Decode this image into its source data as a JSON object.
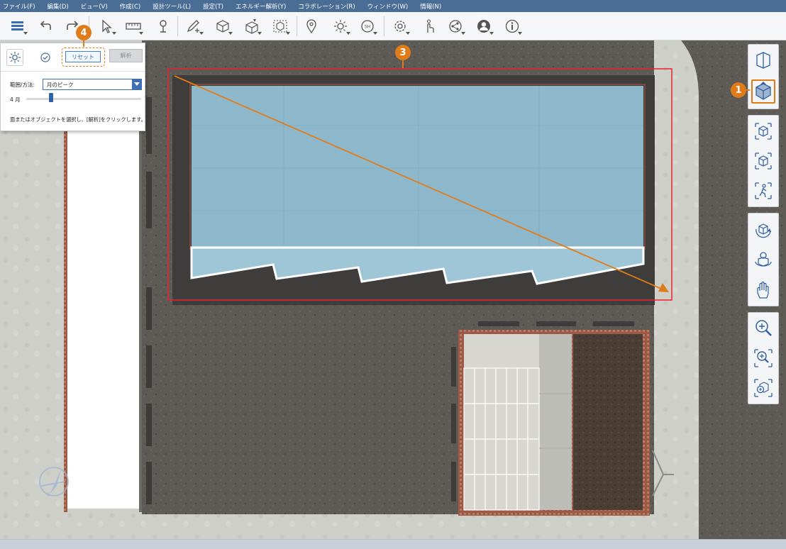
{
  "menu": [
    "ファイル(F)",
    "編集(D)",
    "ビュー(V)",
    "作成(C)",
    "設計ツール(L)",
    "設定(T)",
    "エネルギー解析(Y)",
    "コラボレーション(R)",
    "ウィンドウ(W)",
    "情報(N)"
  ],
  "toolbar": {
    "icons": [
      "layers-icon",
      "undo-icon",
      "redo-icon",
      "select-icon",
      "measure-icon",
      "pin-tool-icon",
      "pencil-add-icon",
      "box-add-icon",
      "box-edit-icon",
      "box-frame-icon",
      "location-icon",
      "sun-icon",
      "sun-hours-icon",
      "settings-icon",
      "gesture-icon",
      "share-icon",
      "account-icon",
      "info-icon"
    ],
    "sun_hours_label": "SH"
  },
  "panel": {
    "reset_label": "リセット",
    "analyze_label": "解析",
    "range_label": "範囲/方法:",
    "range_value": "月のピーク",
    "month_label": "4 月",
    "month_index": 4,
    "month_count": 12,
    "instruction": "面またはオブジェクトを選択し、[解析]をクリックします。"
  },
  "view_toolbar": {
    "groups": [
      [
        "section-view-icon",
        "top-view-icon"
      ],
      [
        "zoom-box-icon",
        "zoom-object-icon",
        "walk-icon"
      ],
      [
        "orbit-icon",
        "orbit-around-icon",
        "pan-hand-icon"
      ],
      [
        "zoom-in-icon",
        "zoom-extents-icon",
        "zoom-fit-icon"
      ]
    ],
    "active": "top-view-icon"
  },
  "callouts": [
    "1",
    "3",
    "4"
  ],
  "colors": {
    "accent": "#e07b1a",
    "selection": "#e8232b",
    "menu_bg": "#4a6d96",
    "pool_water": "#8db8cc"
  }
}
